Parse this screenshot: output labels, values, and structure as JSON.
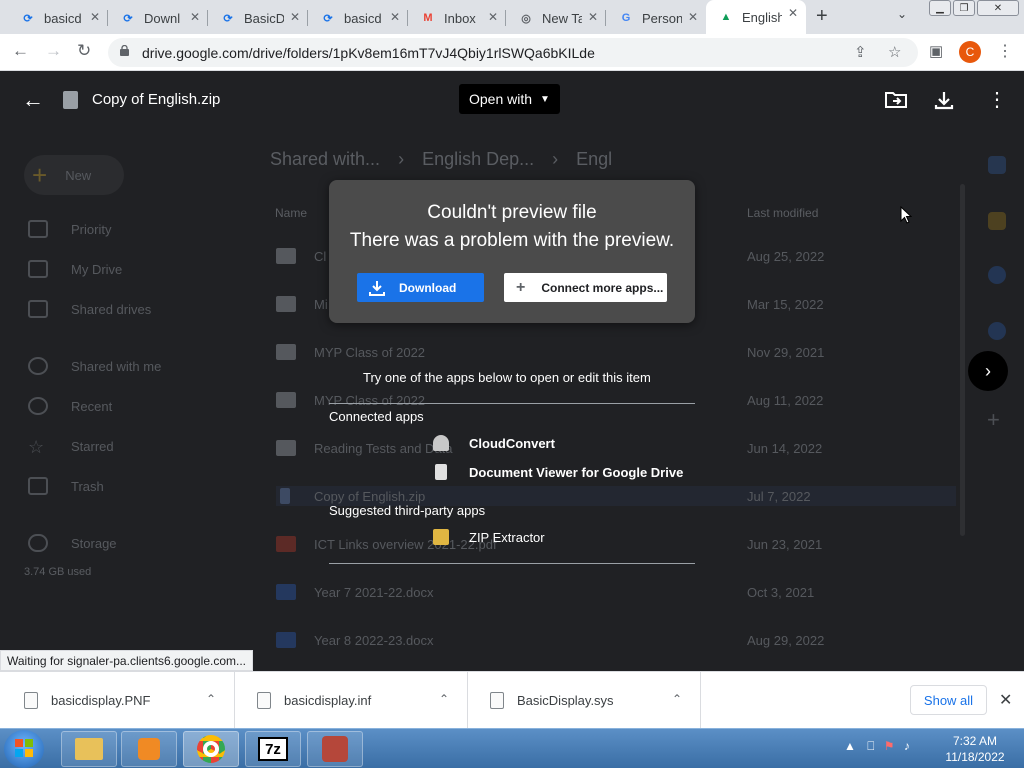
{
  "browser": {
    "tabs": [
      {
        "title": "basicd",
        "color": "#1a73e8",
        "icon": "edge-icon"
      },
      {
        "title": "Downl",
        "color": "#1a73e8",
        "icon": "edge-icon"
      },
      {
        "title": "BasicD",
        "color": "#1a73e8",
        "icon": "edge-icon"
      },
      {
        "title": "basicd",
        "color": "#1a73e8",
        "icon": "edge-icon"
      },
      {
        "title": "Inbox",
        "color": "#ea4335",
        "icon": "gmail-icon"
      },
      {
        "title": "New Ta",
        "color": "#5f6368",
        "icon": "chrome-icon"
      },
      {
        "title": "Person",
        "color": "#4285f4",
        "icon": "google-icon"
      },
      {
        "title": "English",
        "color": "#0f9d58",
        "icon": "drive-icon"
      }
    ],
    "url": "drive.google.com/drive/folders/1pKv8em16mT7vJ4Qbiy1rlSWQa6bKILde",
    "profile_initial": "C"
  },
  "drive": {
    "new_label": "New",
    "sidebar": [
      "Priority",
      "My Drive",
      "Shared drives",
      "Shared with me",
      "Recent",
      "Starred",
      "Trash",
      "Storage"
    ],
    "storage_used": "3.74 GB used",
    "breadcrumb": [
      "Shared with...",
      "English Dep...",
      "Engl"
    ],
    "col_name": "Name",
    "col_modified": "Last modified",
    "rows": [
      {
        "name": "Cl",
        "date": "Aug 25, 2022"
      },
      {
        "name": "Mi",
        "date": "Mar 15, 2022"
      },
      {
        "name": "MYP Class of 2022",
        "date": "Nov 29, 2021"
      },
      {
        "name": "MYP Class of 2022",
        "date": "Aug 11, 2022"
      },
      {
        "name": "Reading Tests and Data",
        "date": "Jun 14, 2022"
      },
      {
        "name": "Copy of English.zip",
        "date": "Jul 7, 2022"
      },
      {
        "name": "ICT Links overview 2021-22.pdf",
        "date": "Jun 23, 2021"
      },
      {
        "name": "Year 7 2021-22.docx",
        "date": "Oct 3, 2021"
      },
      {
        "name": "Year 8 2022-23.docx",
        "date": "Aug 29, 2022"
      }
    ]
  },
  "viewer": {
    "file_name": "Copy of English.zip",
    "open_with": "Open with",
    "error_title": "Couldn't preview file",
    "error_detail": "There was a problem with the preview.",
    "download_label": "Download",
    "connect_label": "Connect more apps...",
    "try_text": "Try one of the apps below to open or edit this item",
    "connected_heading": "Connected apps",
    "connected_apps": [
      "CloudConvert",
      "Document Viewer for Google Drive"
    ],
    "suggested_heading": "Suggested third-party apps",
    "suggested_apps": [
      "ZIP Extractor"
    ]
  },
  "status_text": "Waiting for signaler-pa.clients6.google.com...",
  "downloads": {
    "items": [
      "basicdisplay.PNF",
      "basicdisplay.inf",
      "BasicDisplay.sys"
    ],
    "show_all": "Show all"
  },
  "taskbar": {
    "time": "7:32 AM",
    "date": "11/18/2022",
    "app_7z": "7z"
  }
}
